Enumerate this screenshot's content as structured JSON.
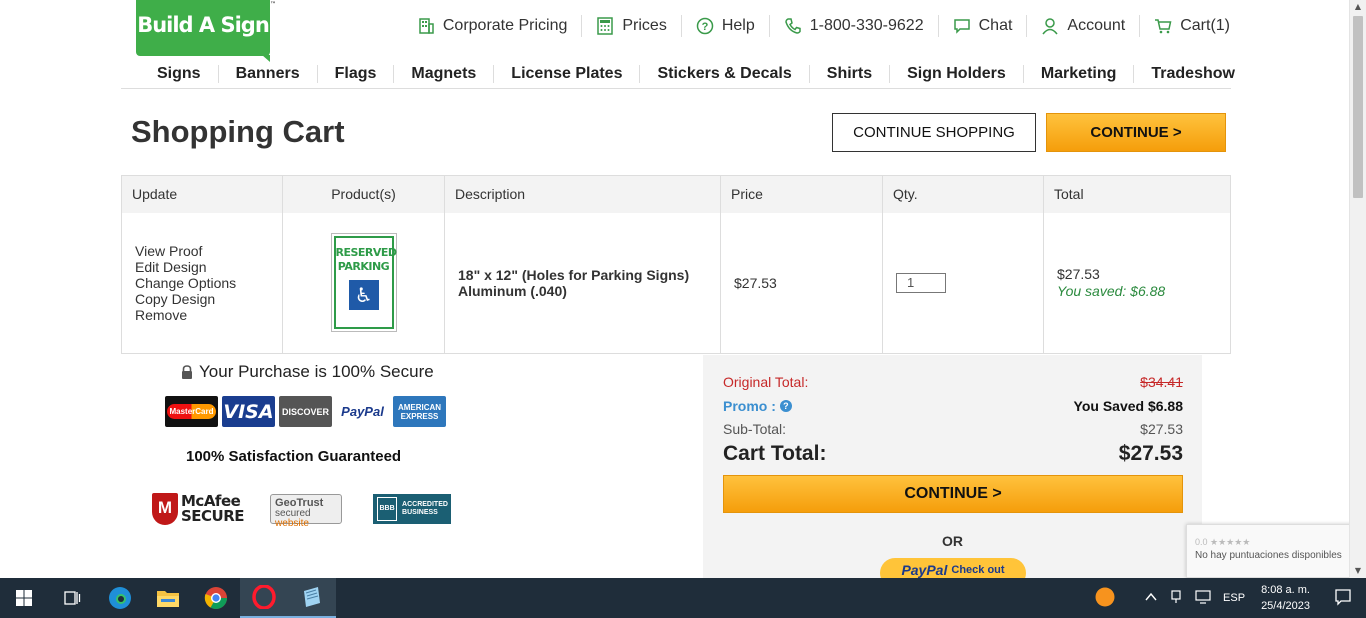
{
  "header": {
    "logo_text": "Build A Sign",
    "top_links": [
      {
        "label": "Corporate Pricing",
        "icon": "building-icon"
      },
      {
        "label": "Prices",
        "icon": "calculator-icon"
      },
      {
        "label": "Help",
        "icon": "help-circle-icon"
      },
      {
        "label": "1-800-330-9622",
        "icon": "phone-icon"
      },
      {
        "label": "Chat",
        "icon": "chat-icon"
      },
      {
        "label": "Account",
        "icon": "user-icon"
      },
      {
        "label": "Cart(1)",
        "icon": "cart-icon"
      }
    ],
    "nav": [
      "Signs",
      "Banners",
      "Flags",
      "Magnets",
      "License Plates",
      "Stickers & Decals",
      "Shirts",
      "Sign Holders",
      "Marketing",
      "Tradeshow"
    ]
  },
  "cart": {
    "title": "Shopping Cart",
    "continue_shopping": "CONTINUE SHOPPING",
    "continue": "CONTINUE >",
    "columns": [
      "Update",
      "Product(s)",
      "Description",
      "Price",
      "Qty.",
      "Total"
    ],
    "item": {
      "actions": [
        "View Proof",
        "Edit Design",
        "Change Options",
        "Copy Design",
        "Remove"
      ],
      "image_text_1": "RESERVED",
      "image_text_2": "PARKING",
      "desc_line1": "18\" x 12\" (Holes for Parking Signs)",
      "desc_line2": "Aluminum (.040)",
      "price": "$27.53",
      "qty": "1",
      "total": "$27.53",
      "saved": "You saved: $6.88"
    }
  },
  "secure": {
    "text": "Your Purchase is 100% Secure",
    "cards": [
      "MasterCard",
      "VISA",
      "DISCOVER",
      "PayPal",
      "AMERICAN EXPRESS"
    ],
    "guarantee": "100% Satisfaction Guaranteed",
    "mcafee_1": "McAfee",
    "mcafee_2": "SECURE",
    "geotrust_1": "GeoTrust",
    "geotrust_2": "secured",
    "geotrust_3": "website",
    "bbb_mark": "BBB",
    "bbb_text_1": "ACCREDITED",
    "bbb_text_2": "BUSINESS"
  },
  "summary": {
    "original_label": "Original Total:",
    "original_value": "$34.41",
    "promo_label": "Promo :",
    "promo_value": "You Saved $6.88",
    "subtotal_label": "Sub-Total:",
    "subtotal_value": "$27.53",
    "total_label": "Cart Total:",
    "total_value": "$27.53",
    "continue": "CONTINUE >",
    "or": "OR",
    "paypal_label": "PayPal",
    "paypal_checkout": "Check out"
  },
  "recaptcha": {
    "rating": "0.0",
    "text": "No hay puntuaciones disponibles"
  },
  "taskbar": {
    "lang": "ESP",
    "time": "8:08 a. m.",
    "date": "25/4/2023"
  }
}
